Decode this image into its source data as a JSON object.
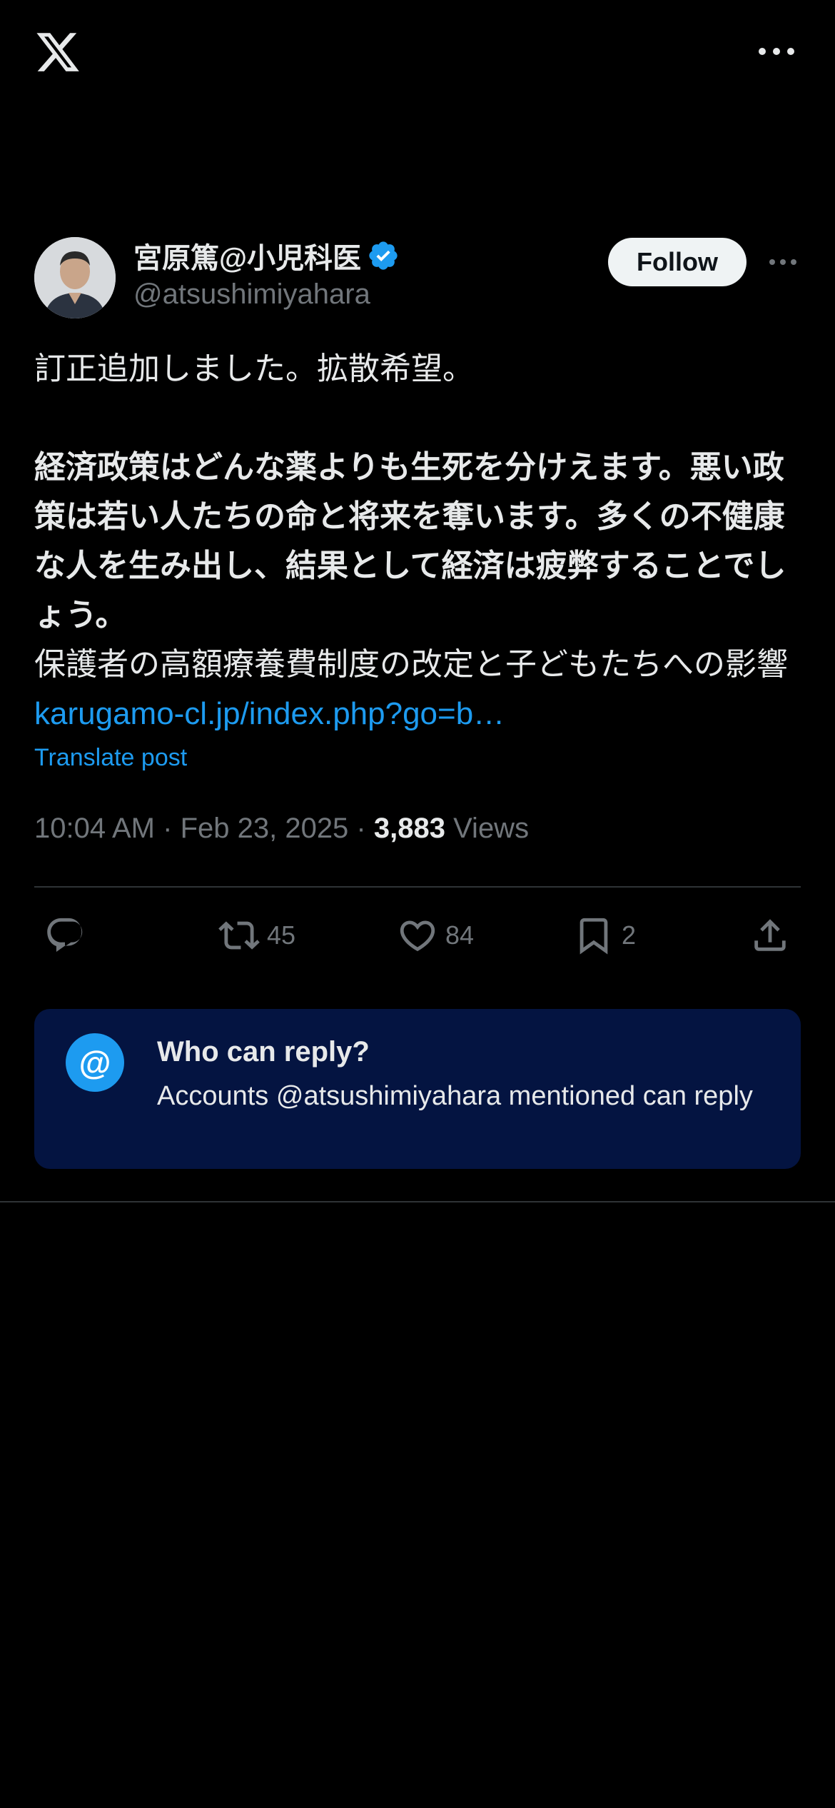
{
  "header": {
    "logo_icon": "x-logo-icon",
    "more_icon": "more-horizontal-icon"
  },
  "author": {
    "display_name": "宮原篤@小児科医",
    "handle": "@atsushimiyahara",
    "verified": true,
    "follow_label": "Follow"
  },
  "tweet": {
    "line1": "訂正追加しました。拡散希望。",
    "bold_text": "経済政策はどんな薬よりも生死を分けえます。悪い政策は若い人たちの命と将来を奪います。多くの不健康な人を生み出し、結果として経済は疲弊することでしょう。",
    "normal_text": "保護者の高額療養費制度の改定と子どもたちへの影響",
    "link_text": "karugamo-cl.jp/index.php?go=b…",
    "translate_label": "Translate post"
  },
  "meta": {
    "time": "10:04 AM",
    "separator": " · ",
    "date": "Feb 23, 2025",
    "views_count": "3,883",
    "views_label": "Views"
  },
  "actions": {
    "reply_count": "",
    "retweet_count": "45",
    "like_count": "84",
    "bookmark_count": "2"
  },
  "reply_restriction": {
    "title": "Who can reply?",
    "description": "Accounts @atsushimiyahara mentioned can reply",
    "icon_symbol": "@"
  },
  "colors": {
    "background": "#000000",
    "accent": "#1d9bf0",
    "card_background": "#041441",
    "muted_text": "#71767b"
  }
}
